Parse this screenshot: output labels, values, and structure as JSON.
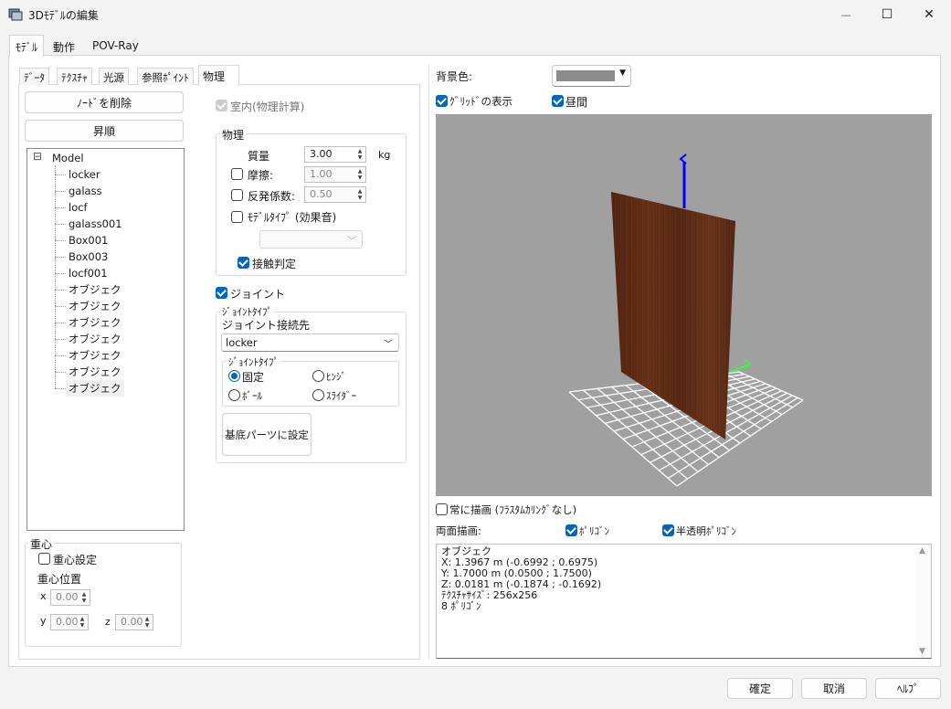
{
  "window": {
    "title": "3Dﾓﾃﾞﾙの編集",
    "controls": {
      "minimize": "—",
      "maximize": "☐",
      "close": "✕"
    }
  },
  "outer_tabs": [
    "ﾓﾃﾞﾙ",
    "動作",
    "POV-Ray"
  ],
  "inner_tabs": [
    "ﾃﾞｰﾀ",
    "ﾃｸｽﾁｬ",
    "光源",
    "参照ﾎﾟｲﾝﾄ",
    "物理"
  ],
  "left": {
    "delete_node_label": "ﾉｰﾄﾞを削除",
    "sort_asc_label": "昇順",
    "tree": {
      "root": "Model",
      "expander": "⊟",
      "children": [
        "locker",
        "galass",
        "locf",
        "galass001",
        "Box001",
        "Box003",
        "locf001",
        "オブジェク",
        "オブジェク",
        "オブジェク",
        "オブジェク",
        "オブジェク",
        "オブジェク",
        "オブジェク"
      ]
    },
    "center_of_gravity": {
      "group_label": "重心",
      "set_label": "重心設定",
      "position_label": "重心位置",
      "x_label": "x",
      "x_value": "0.00",
      "y_label": "y",
      "y_value": "0.00",
      "z_label": "z",
      "z_value": "0.00"
    }
  },
  "physics": {
    "indoor_label": "室内(物理計算)",
    "group_label": "物理",
    "mass_label": "質量",
    "mass_value": "3.00",
    "mass_unit": "kg",
    "friction_label": "摩擦:",
    "friction_value": "1.00",
    "restitution_label": "反発係数:",
    "restitution_value": "0.50",
    "model_type_label": "ﾓﾃﾞﾙﾀｲﾌﾟ (効果音)",
    "contact_label": "接触判定",
    "joint_label": "ジョイント",
    "joint_type_group": "ｼﾞｮｲﾝﾄﾀｲﾌﾟ",
    "joint_target_label": "ジョイント接続先",
    "joint_target_value": "locker",
    "joint_type_inner": "ｼﾞｮｲﾝﾄﾀｲﾌﾟ",
    "joint_types": [
      "固定",
      "ﾋﾝｼﾞ",
      "ﾎﾞｰﾙ",
      "ｽﾗｲﾀﾞｰ"
    ],
    "set_base_label": "基底パーツに設定"
  },
  "right": {
    "bg_color_label": "背景色:",
    "bg_color": "#8c8c8c",
    "grid_label": "ｸﾞﾘｯﾄﾞの表示",
    "daytime_label": "昼間",
    "always_draw_label": "常に描画 (ﾌﾗｽﾀﾑｶﾘﾝｸﾞなし)",
    "double_sided_label": "両面描画:",
    "polygon_label": "ﾎﾟﾘｺﾞﾝ",
    "translucent_label": "半透明ﾎﾟﾘｺﾞﾝ",
    "info_text": "オブジェク\nX: 1.3967 m (-0.6992 ; 0.6975)\nY: 1.7000 m (0.0500 ; 1.7500)\nZ: 0.0181 m (-0.1874 ; -0.1692)\nﾃｸｽﾁｬｻｲｽﾞ: 256x256\n8 ﾎﾟﾘｺﾞﾝ"
  },
  "footer": {
    "ok_label": "確定",
    "cancel_label": "取消",
    "help_label": "ﾍﾙﾌﾟ"
  },
  "colors": {
    "accent": "#0067c0",
    "viewport_bg": "#a0a0a0",
    "panel_wood": "#5a2a14",
    "y_axis": "#0000ff",
    "x_axis": "#33ff33"
  }
}
